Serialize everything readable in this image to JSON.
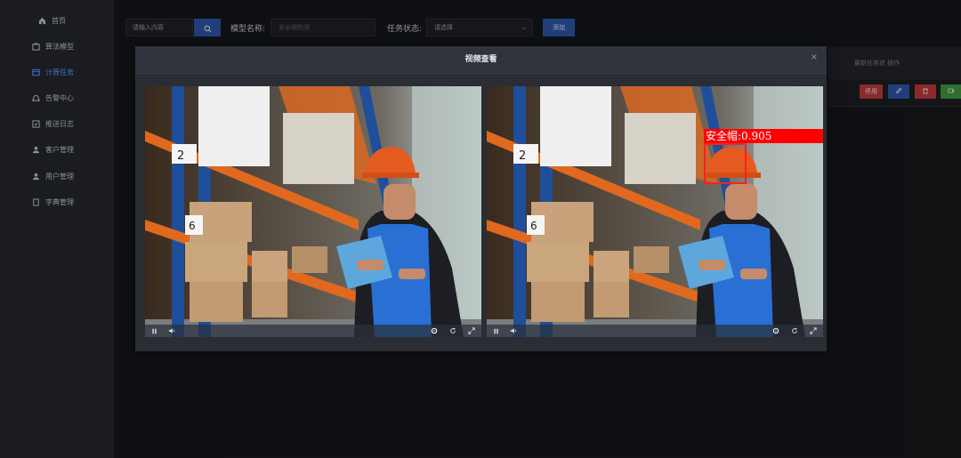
{
  "sidebar": {
    "items": [
      {
        "label": "首页",
        "icon": "home-icon"
      },
      {
        "label": "算法模型",
        "icon": "model-icon"
      },
      {
        "label": "计算任务",
        "icon": "task-icon",
        "active": true
      },
      {
        "label": "告警中心",
        "icon": "bell-icon"
      },
      {
        "label": "推送日志",
        "icon": "log-icon"
      },
      {
        "label": "客户管理",
        "icon": "user-icon"
      },
      {
        "label": "用户管理",
        "icon": "user-icon"
      },
      {
        "label": "字典管理",
        "icon": "dict-icon"
      }
    ]
  },
  "toolbar": {
    "search_placeholder": "请输入内容",
    "model_label": "模型名称:",
    "model_placeholder": "安全帽检测",
    "status_label": "任务状态:",
    "status_value": "请选择",
    "add_label": "添加"
  },
  "table": {
    "header_text": "最新任务状  操作",
    "actions": [
      "停用",
      "✎",
      "🗑",
      "▭"
    ]
  },
  "modal": {
    "title": "视频查看",
    "close": "×",
    "detection": {
      "label": "安全帽:0.905"
    }
  },
  "colors": {
    "accent": "#2d56a8",
    "active_menu": "#3e72c9",
    "detect": "#ff0000"
  }
}
